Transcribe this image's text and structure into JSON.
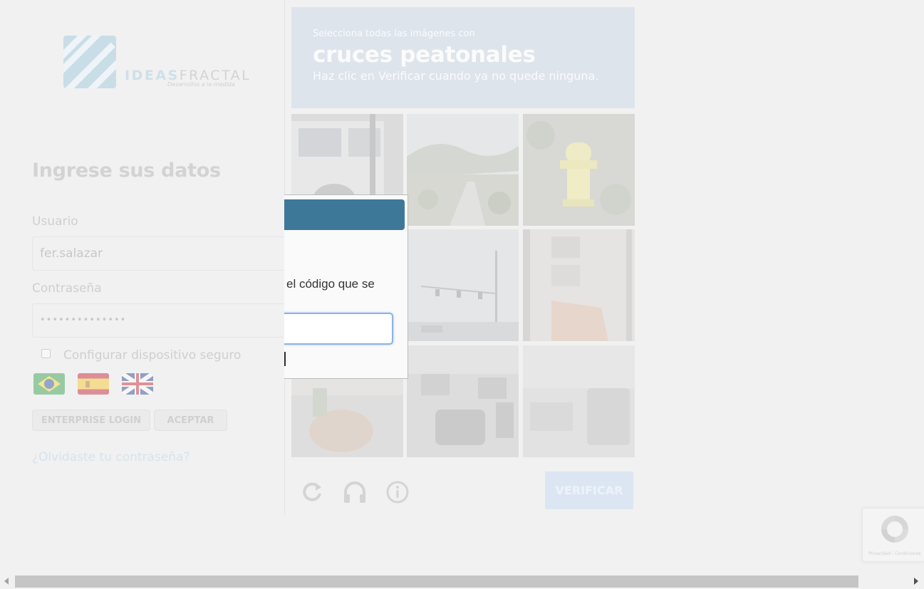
{
  "login": {
    "logo_word_a": "IDEAS",
    "logo_word_b": "FRACTAL",
    "logo_tagline": "Desarrollos a la medida",
    "title": "Ingrese sus datos",
    "username_label": "Usuario",
    "username_value": "fer.salazar",
    "password_label": "Contraseña",
    "password_value": "••••••••••••••",
    "secure_device_label": "Configurar dispositivo seguro",
    "secure_device_checked": false,
    "languages": [
      "pt-BR",
      "es",
      "en-GB"
    ],
    "enterprise_login_label": "ENTERPRISE LOGIN",
    "accept_label": "ACEPTAR",
    "forgot_password_link": "¿Olvidaste tu contraseña?"
  },
  "captcha": {
    "instruction_small": "Selecciona todas las imágenes con",
    "target": "cruces peatonales",
    "instruction_sub": "Haz clic en Verificar cuando ya no quede ninguna.",
    "verify_label": "VERIFICAR",
    "tiles": [
      {
        "name": "tile-1",
        "subject": "truck on street"
      },
      {
        "name": "tile-2",
        "subject": "road in landscape"
      },
      {
        "name": "tile-3",
        "subject": "yellow fire hydrant"
      },
      {
        "name": "tile-4",
        "subject": "street"
      },
      {
        "name": "tile-5",
        "subject": "traffic lights"
      },
      {
        "name": "tile-6",
        "subject": "building facade"
      },
      {
        "name": "tile-7",
        "subject": "planters on sidewalk"
      },
      {
        "name": "tile-8",
        "subject": "traffic with cars"
      },
      {
        "name": "tile-9",
        "subject": "parked cars"
      }
    ]
  },
  "modal": {
    "prompt_text": "el código que se",
    "code_value": ""
  },
  "badge": {
    "text": "Privacidad - Condiciones"
  },
  "colors": {
    "modal_header": "#3e7898",
    "input_focus": "#8cb3e6",
    "verify_button": "#dce6f3"
  }
}
